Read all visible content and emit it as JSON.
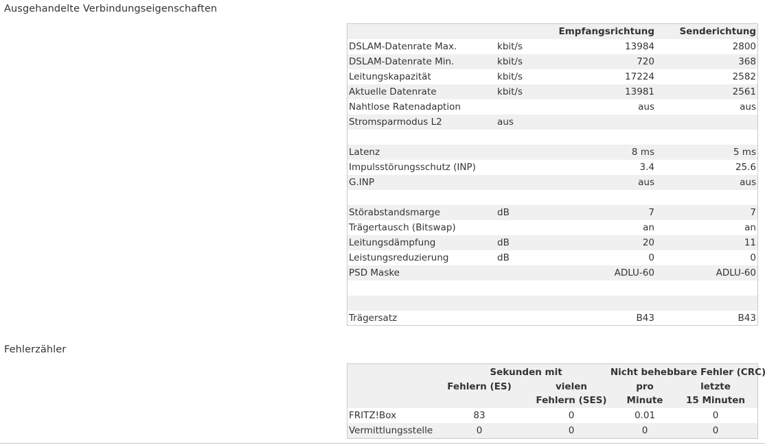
{
  "sections": {
    "properties_title": "Ausgehandelte Verbindungseigenschaften",
    "errors_title": "Fehlerzähler"
  },
  "properties": {
    "headers": {
      "rx": "Empfangsrichtung",
      "tx": "Senderichtung"
    },
    "rows": [
      {
        "label": "DSLAM-Datenrate Max.",
        "unit": "kbit/s",
        "rx": "13984",
        "tx": "2800"
      },
      {
        "label": "DSLAM-Datenrate Min.",
        "unit": "kbit/s",
        "rx": "720",
        "tx": "368"
      },
      {
        "label": "Leitungskapazität",
        "unit": "kbit/s",
        "rx": "17224",
        "tx": "2582"
      },
      {
        "label": "Aktuelle Datenrate",
        "unit": "kbit/s",
        "rx": "13981",
        "tx": "2561"
      },
      {
        "label": "Nahtlose Ratenadaption",
        "unit": "",
        "rx": "aus",
        "tx": "aus"
      },
      {
        "label": "Stromsparmodus L2",
        "unit": "aus",
        "rx": "",
        "tx": ""
      },
      {
        "label": "",
        "unit": "",
        "rx": "",
        "tx": ""
      },
      {
        "label": "Latenz",
        "unit": "",
        "rx": "8 ms",
        "tx": "5 ms"
      },
      {
        "label": "Impulsstörungsschutz (INP)",
        "unit": "",
        "rx": "3.4",
        "tx": "25.6"
      },
      {
        "label": "G.INP",
        "unit": "",
        "rx": "aus",
        "tx": "aus"
      },
      {
        "label": "",
        "unit": "",
        "rx": "",
        "tx": ""
      },
      {
        "label": "Störabstandsmarge",
        "unit": "dB",
        "rx": "7",
        "tx": "7"
      },
      {
        "label": "Trägertausch (Bitswap)",
        "unit": "",
        "rx": "an",
        "tx": "an"
      },
      {
        "label": "Leitungsdämpfung",
        "unit": "dB",
        "rx": "20",
        "tx": "11"
      },
      {
        "label": "Leistungsreduzierung",
        "unit": "dB",
        "rx": "0",
        "tx": "0"
      },
      {
        "label": "PSD Maske",
        "unit": "",
        "rx": "ADLU-60",
        "tx": "ADLU-60"
      },
      {
        "label": "",
        "unit": "",
        "rx": "",
        "tx": ""
      },
      {
        "label": "",
        "unit": "",
        "rx": "",
        "tx": ""
      },
      {
        "label": "Trägersatz",
        "unit": "",
        "rx": "B43",
        "tx": "B43"
      }
    ]
  },
  "errors": {
    "group_seconds": "Sekunden mit",
    "group_crc": "Nicht behebbare Fehler (CRC)",
    "col_es": "Fehlern (ES)",
    "col_ses_1": "vielen",
    "col_ses_2": "Fehlern (SES)",
    "col_pm_1": "pro",
    "col_pm_2": "Minute",
    "col_15_1": "letzte",
    "col_15_2": "15 Minuten",
    "rows": [
      {
        "label": "FRITZ!Box",
        "es": "83",
        "ses": "0",
        "per_min": "0.01",
        "last15": "0"
      },
      {
        "label": "Vermittlungsstelle",
        "es": "0",
        "ses": "0",
        "per_min": "0",
        "last15": "0"
      }
    ]
  }
}
